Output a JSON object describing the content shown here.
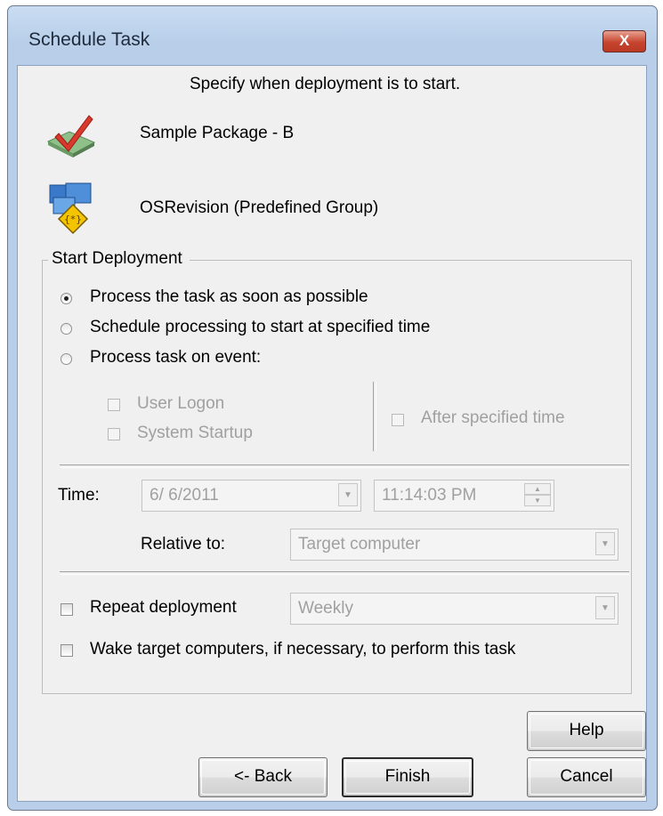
{
  "window": {
    "title": "Schedule Task",
    "close_label": "X"
  },
  "header": {
    "instruction": "Specify when deployment is to start."
  },
  "package": {
    "name": "Sample Package - B",
    "icon": "package-check-icon"
  },
  "group": {
    "name": "OSRevision (Predefined Group)",
    "icon": "computer-group-icon"
  },
  "start_deployment": {
    "legend": "Start Deployment",
    "options": [
      {
        "label": "Process the task as soon as possible",
        "checked": true
      },
      {
        "label": "Schedule processing to start at specified time",
        "checked": false
      },
      {
        "label": "Process task on event:",
        "checked": false
      }
    ],
    "events": {
      "user_logon": "User Logon",
      "system_startup": "System Startup",
      "after_specified_time": "After specified time"
    },
    "time_label": "Time:",
    "date_value": "6/  6/2011",
    "time_value": "11:14:03 PM",
    "relative_label": "Relative to:",
    "relative_value": "Target computer",
    "repeat_label": "Repeat deployment",
    "repeat_value": "Weekly",
    "wake_label": "Wake target computers, if necessary, to perform this task"
  },
  "buttons": {
    "help": "Help",
    "back": "<- Back",
    "finish": "Finish",
    "cancel": "Cancel"
  },
  "colors": {
    "title_bar": "#c9dcf2",
    "close_button": "#c7442f",
    "dialog_bg": "#f0f0f0"
  }
}
